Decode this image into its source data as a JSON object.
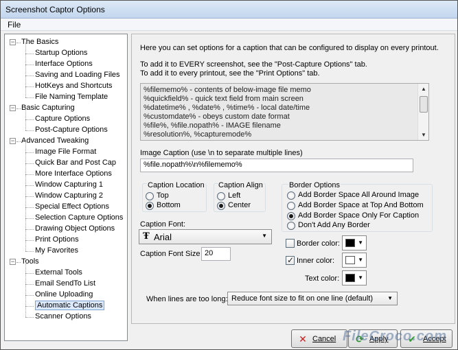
{
  "window": {
    "title": "Screenshot Captor Options"
  },
  "menu": {
    "file": "File"
  },
  "tree": [
    {
      "label": "The Basics",
      "level": 0,
      "expander": "−"
    },
    {
      "label": "Startup Options",
      "level": 1
    },
    {
      "label": "Interface Options",
      "level": 1
    },
    {
      "label": "Saving and Loading Files",
      "level": 1
    },
    {
      "label": "HotKeys and Shortcuts",
      "level": 1
    },
    {
      "label": "File Naming Template",
      "level": 1
    },
    {
      "label": "Basic Capturing",
      "level": 0,
      "expander": "−"
    },
    {
      "label": "Capture Options",
      "level": 1
    },
    {
      "label": "Post-Capture Options",
      "level": 1
    },
    {
      "label": "Advanced Tweaking",
      "level": 0,
      "expander": "−"
    },
    {
      "label": "Image File Format",
      "level": 1
    },
    {
      "label": "Quick Bar and Post Cap",
      "level": 1
    },
    {
      "label": "More Interface Options",
      "level": 1
    },
    {
      "label": "Window Capturing 1",
      "level": 1
    },
    {
      "label": "Window Capturing 2",
      "level": 1
    },
    {
      "label": "Special Effect Options",
      "level": 1
    },
    {
      "label": "Selection Capture Options",
      "level": 1
    },
    {
      "label": "Drawing Object Options",
      "level": 1
    },
    {
      "label": "Print Options",
      "level": 1
    },
    {
      "label": "My Favorites",
      "level": 1
    },
    {
      "label": "Tools",
      "level": 0,
      "expander": "−"
    },
    {
      "label": "External Tools",
      "level": 1
    },
    {
      "label": "Email SendTo List",
      "level": 1
    },
    {
      "label": "Online Uploading",
      "level": 1
    },
    {
      "label": "Automatic Captions",
      "level": 1,
      "selected": true
    },
    {
      "label": "Scanner Options",
      "level": 1
    }
  ],
  "panel": {
    "intro": "Here you can set options for a caption that can be configured to display on every printout.",
    "hint1": "To add it to EVERY screenshot, see the \"Post-Capture Options\" tab.",
    "hint2": "To add it to every printout, see the \"Print Options\" tab.",
    "macros": [
      "%filememo% - contents of below-image file memo",
      "%quickfield% - quick text field from main screen",
      "%datetime% , %date% , %time% - local date/time",
      "%customdate% - obeys custom date format",
      "%file%, %file.nopath% - IMAGE filename",
      "%resolution%, %capturemode%"
    ],
    "image_caption_label": "Image Caption (use \\n to separate multiple lines)",
    "image_caption_value": "%file.nopath%\\n%filememo%",
    "caption_location": {
      "title": "Caption Location",
      "options": [
        "Top",
        "Bottom"
      ],
      "selected": "Bottom"
    },
    "caption_align": {
      "title": "Caption Align",
      "options": [
        "Left",
        "Center"
      ],
      "selected": "Center"
    },
    "border_options": {
      "title": "Border Options",
      "options": [
        "Add Border Space All Around Image",
        "Add Border Space at Top And Bottom",
        "Add Border Space Only For Caption",
        "Don't Add Any Border"
      ],
      "selected": "Add Border Space Only For Caption"
    },
    "caption_font_label": "Caption Font:",
    "caption_font_value": "Arial",
    "caption_font_icon": "truetype-font-icon",
    "caption_font_size_label": "Caption Font Size",
    "caption_font_size_value": "20",
    "border_color": {
      "label": "Border color:",
      "checked": false,
      "color": "#000000"
    },
    "inner_color": {
      "label": "Inner color:",
      "checked": true,
      "color": "#ffffff"
    },
    "text_color": {
      "label": "Text color:",
      "color": "#000000"
    },
    "too_long_label": "When lines are too long:",
    "too_long_value": "Reduce font size to fit on one line (default)"
  },
  "buttons": {
    "cancel": {
      "label": "Cancel",
      "icon": "x-icon",
      "color": "#c81e1e"
    },
    "apply": {
      "label": "Apply",
      "icon": "refresh-icon",
      "color": "#2f8f2f"
    },
    "accept": {
      "label": "Accept",
      "icon": "checkmark-icon",
      "color": "#2f9d2f"
    }
  },
  "watermark": "FileCroco.com"
}
